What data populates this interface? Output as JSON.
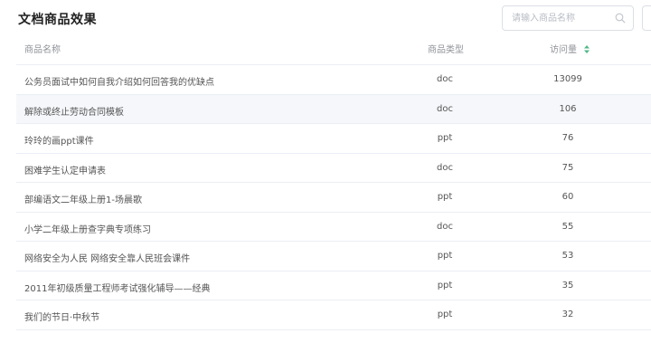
{
  "header": {
    "title": "文档商品效果"
  },
  "search": {
    "placeholder": "请输入商品名称",
    "value": "",
    "icon": "search-icon"
  },
  "table": {
    "columns": {
      "name": "商品名称",
      "type": "商品类型",
      "visits": "访问量"
    },
    "sort": {
      "column": "visits",
      "icon": "sort-icon",
      "active_color": "#52b788"
    },
    "rows": [
      {
        "name": "公务员面试中如何自我介绍如何回答我的优缺点",
        "type": "doc",
        "visits": "13099"
      },
      {
        "name": "解除或终止劳动合同模板",
        "type": "doc",
        "visits": "106"
      },
      {
        "name": "玲玲的画ppt课件",
        "type": "ppt",
        "visits": "76"
      },
      {
        "name": "困难学生认定申请表",
        "type": "doc",
        "visits": "75"
      },
      {
        "name": "部编语文二年级上册1-场晨歌",
        "type": "ppt",
        "visits": "60"
      },
      {
        "name": "小学二年级上册查字典专项练习",
        "type": "doc",
        "visits": "55"
      },
      {
        "name": "网络安全为人民 网络安全靠人民班会课件",
        "type": "ppt",
        "visits": "53"
      },
      {
        "name": "2011年初级质量工程师考试强化辅导——经典",
        "type": "ppt",
        "visits": "35"
      },
      {
        "name": "我们的节日·中秋节",
        "type": "ppt",
        "visits": "32"
      }
    ]
  }
}
